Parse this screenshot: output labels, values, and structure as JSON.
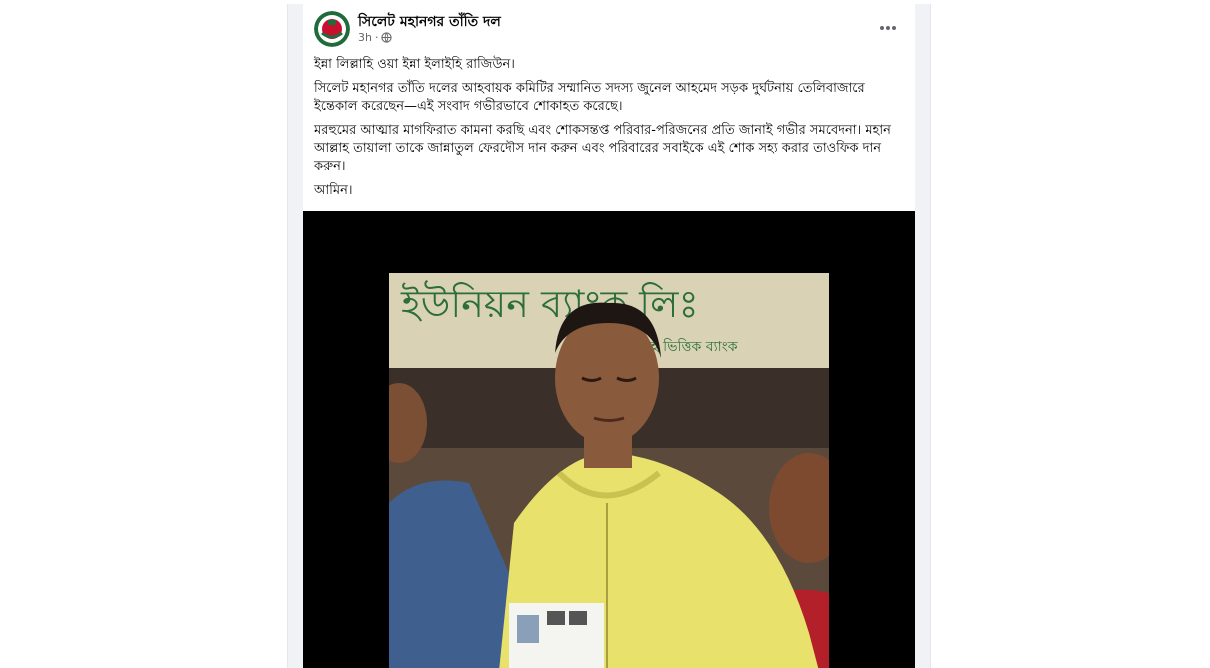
{
  "post": {
    "page_name": "সিলেট মহানগর তাঁতি দল",
    "time": "3h",
    "separator": "·",
    "more_icon": "more-horizontal-icon",
    "privacy_icon": "globe-icon",
    "paragraphs": [
      "ইন্না লিল্লাহি ওয়া ইন্না ইলাইহি রাজিউন।",
      "সিলেট মহানগর তাঁতি দলের আহবায়ক কমিটির সম্মানিত সদস্য জুনেল আহমেদ সড়ক দুর্ঘটনায় তেলিবাজারে ইন্তেকাল করেছেন—এই সংবাদ গভীরভাবে শোকাহত করেছে।",
      "মরহুমের আত্মার মাগফিরাত কামনা করছি এবং শোকসন্তপ্ত পরিবার-পরিজনের প্রতি জানাই গভীর সমবেদনা। মহান আল্লাহ তায়ালা তাকে জান্নাতুল ফেরদৌস দান করুন এবং পরিবারের সবাইকে এই শোক সহ্য করার তাওফিক দান করুন।",
      "আমিন।"
    ]
  },
  "photo": {
    "sign_text": "ইউনিয়ন ব্যাংক লিঃ",
    "sign_subtext": "শরীয়াহ ভিত্তিক ব্যাংক",
    "colors": {
      "sign_bg": "#d9d2b4",
      "sign_text": "#2c6e3a",
      "hoodie": "#e8e16b",
      "skin": "#8a5a3c"
    }
  }
}
